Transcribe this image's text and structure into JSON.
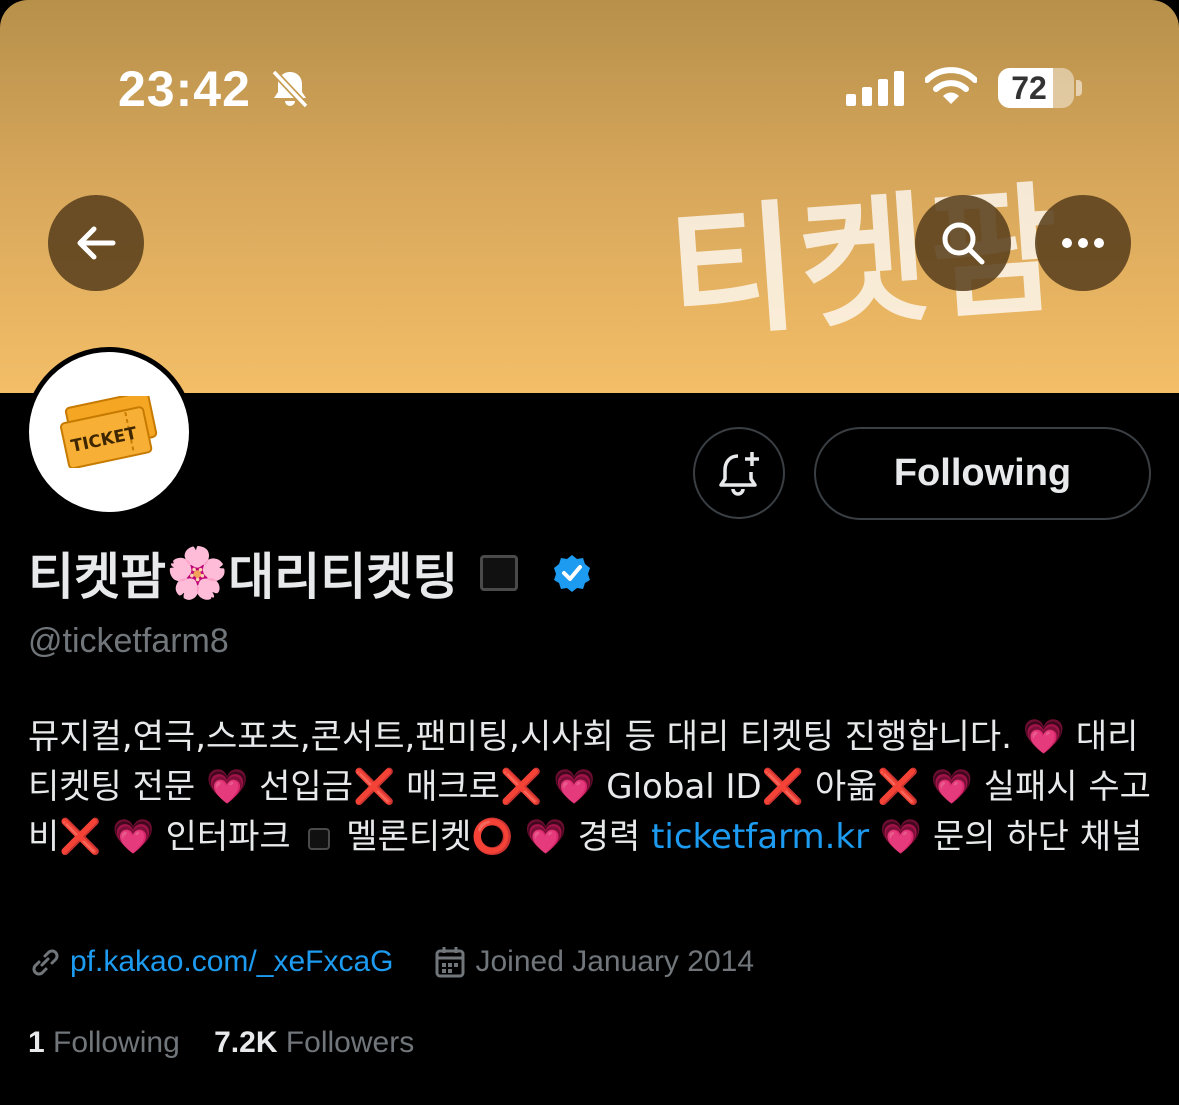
{
  "status_bar": {
    "time": "23:42",
    "battery": "72",
    "battery_fraction": 0.72
  },
  "banner": {
    "text": "티켓팜"
  },
  "profile": {
    "name_part1": "티켓팜",
    "name_emoji": "🌸",
    "name_part2": "대리티켓팅",
    "handle": "@ticketfarm8",
    "bio": {
      "seg1": "뮤지컬,연극,스포츠,콘서트,팬미팅,시사회 등 대리 티켓팅 진행합니다. 💗 대리 티켓팅 전문 💗 선입금❌ 매크로❌ 💗 Global ID❌ 아옮❌ 💗 실패시 수고비❌ 💗 인터파크 ",
      "seg2": " 멜론티켓⭕️ 💗 경력 ",
      "link": "ticketfarm.kr",
      "seg3": " 💗 문의 하단 채널"
    },
    "website": "pf.kakao.com/_xeFxcaG",
    "joined": "Joined January 2014",
    "following_count": "1",
    "following_label": "Following",
    "followers_count": "7.2K",
    "followers_label": "Followers"
  },
  "actions": {
    "following_button": "Following"
  },
  "icons": {
    "back": "back-arrow-icon",
    "search": "search-icon",
    "more": "more-icon",
    "notify": "notification-add-icon",
    "verified": "verified-badge-icon",
    "link": "link-icon",
    "calendar": "calendar-icon"
  },
  "colors": {
    "accent": "#1d9bf0",
    "text_primary": "#e7e9ea",
    "text_secondary": "#71767b",
    "background": "#000000"
  }
}
